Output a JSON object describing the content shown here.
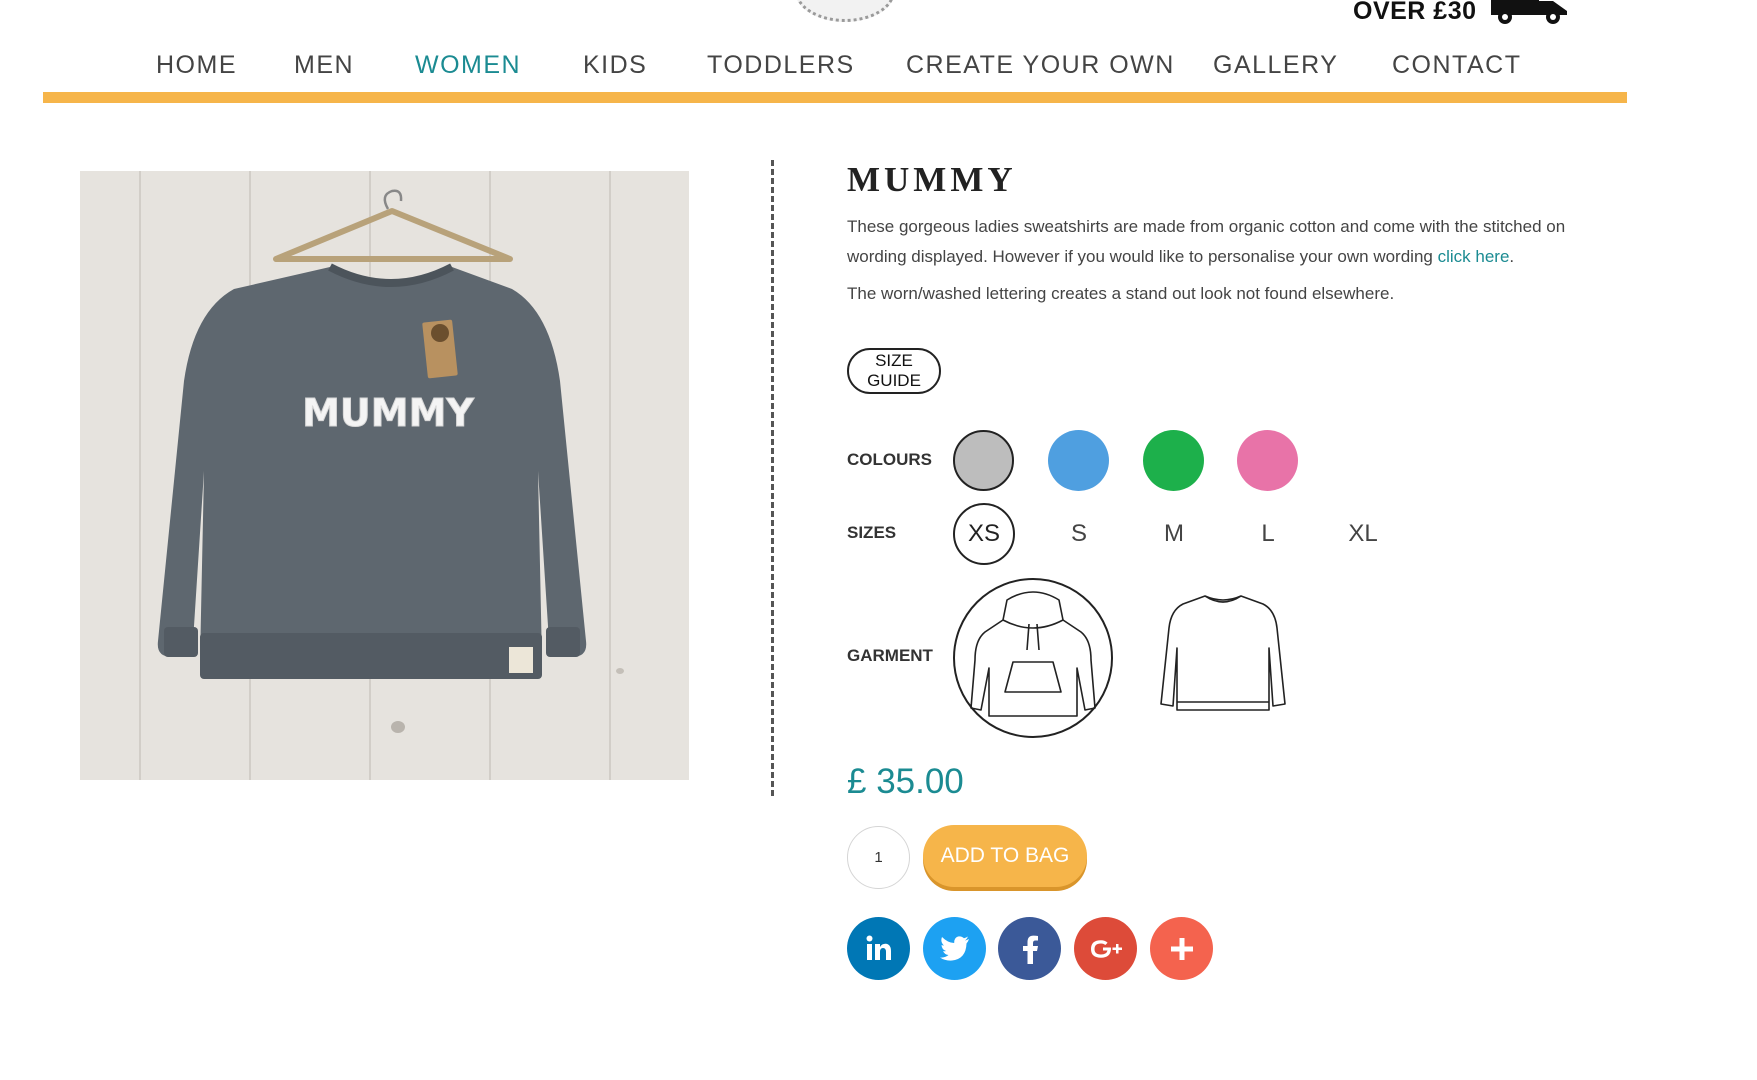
{
  "header": {
    "promo_text": "OVER £30",
    "truck_icon": "delivery-truck-icon"
  },
  "nav": {
    "items": [
      {
        "label": "HOME",
        "active": false
      },
      {
        "label": "MEN",
        "active": false
      },
      {
        "label": "WOMEN",
        "active": true
      },
      {
        "label": "KIDS",
        "active": false
      },
      {
        "label": "TODDLERS",
        "active": false
      },
      {
        "label": "CREATE YOUR OWN",
        "active": false
      },
      {
        "label": "GALLERY",
        "active": false
      },
      {
        "label": "CONTACT",
        "active": false
      }
    ],
    "accent_color": "#f6b54a",
    "active_color": "#1b8b92"
  },
  "product": {
    "image_print_text": "MUMMY",
    "title": "MUMMY",
    "description_before_link": "These gorgeous ladies sweatshirts are made from organic cotton and come with the stitched on wording displayed. However if you would like to personalise your own wording ",
    "description_link": "click here",
    "description_after_link": ".",
    "description_2": "The worn/washed lettering creates a stand out look not found elsewhere.",
    "size_guide_label": "SIZE GUIDE",
    "colours_label": "COLOURS",
    "colours": [
      {
        "name": "grey",
        "hex": "#bdbdbd",
        "selected": true
      },
      {
        "name": "blue",
        "hex": "#4f9fe0",
        "selected": false
      },
      {
        "name": "green",
        "hex": "#1db04b",
        "selected": false
      },
      {
        "name": "pink",
        "hex": "#e873a8",
        "selected": false
      }
    ],
    "sizes_label": "SIZES",
    "sizes": [
      {
        "label": "XS",
        "selected": true
      },
      {
        "label": "S",
        "selected": false
      },
      {
        "label": "M",
        "selected": false
      },
      {
        "label": "L",
        "selected": false
      },
      {
        "label": "XL",
        "selected": false
      }
    ],
    "garment_label": "GARMENT",
    "garments": [
      {
        "icon": "hoodie-icon",
        "selected": true
      },
      {
        "icon": "sweatshirt-icon",
        "selected": false
      }
    ],
    "price": "£ 35.00",
    "quantity": "1",
    "add_to_bag_label": "ADD TO BAG"
  },
  "social": [
    {
      "icon": "linkedin-icon",
      "glyph": "in",
      "color": "#0077b5"
    },
    {
      "icon": "twitter-icon",
      "glyph": "",
      "color": "#1da1f2"
    },
    {
      "icon": "facebook-icon",
      "glyph": "f",
      "color": "#3b5998"
    },
    {
      "icon": "google-plus-icon",
      "glyph": "G+",
      "color": "#dd4b39"
    },
    {
      "icon": "share-more-icon",
      "glyph": "+",
      "color": "#f4634e"
    }
  ]
}
